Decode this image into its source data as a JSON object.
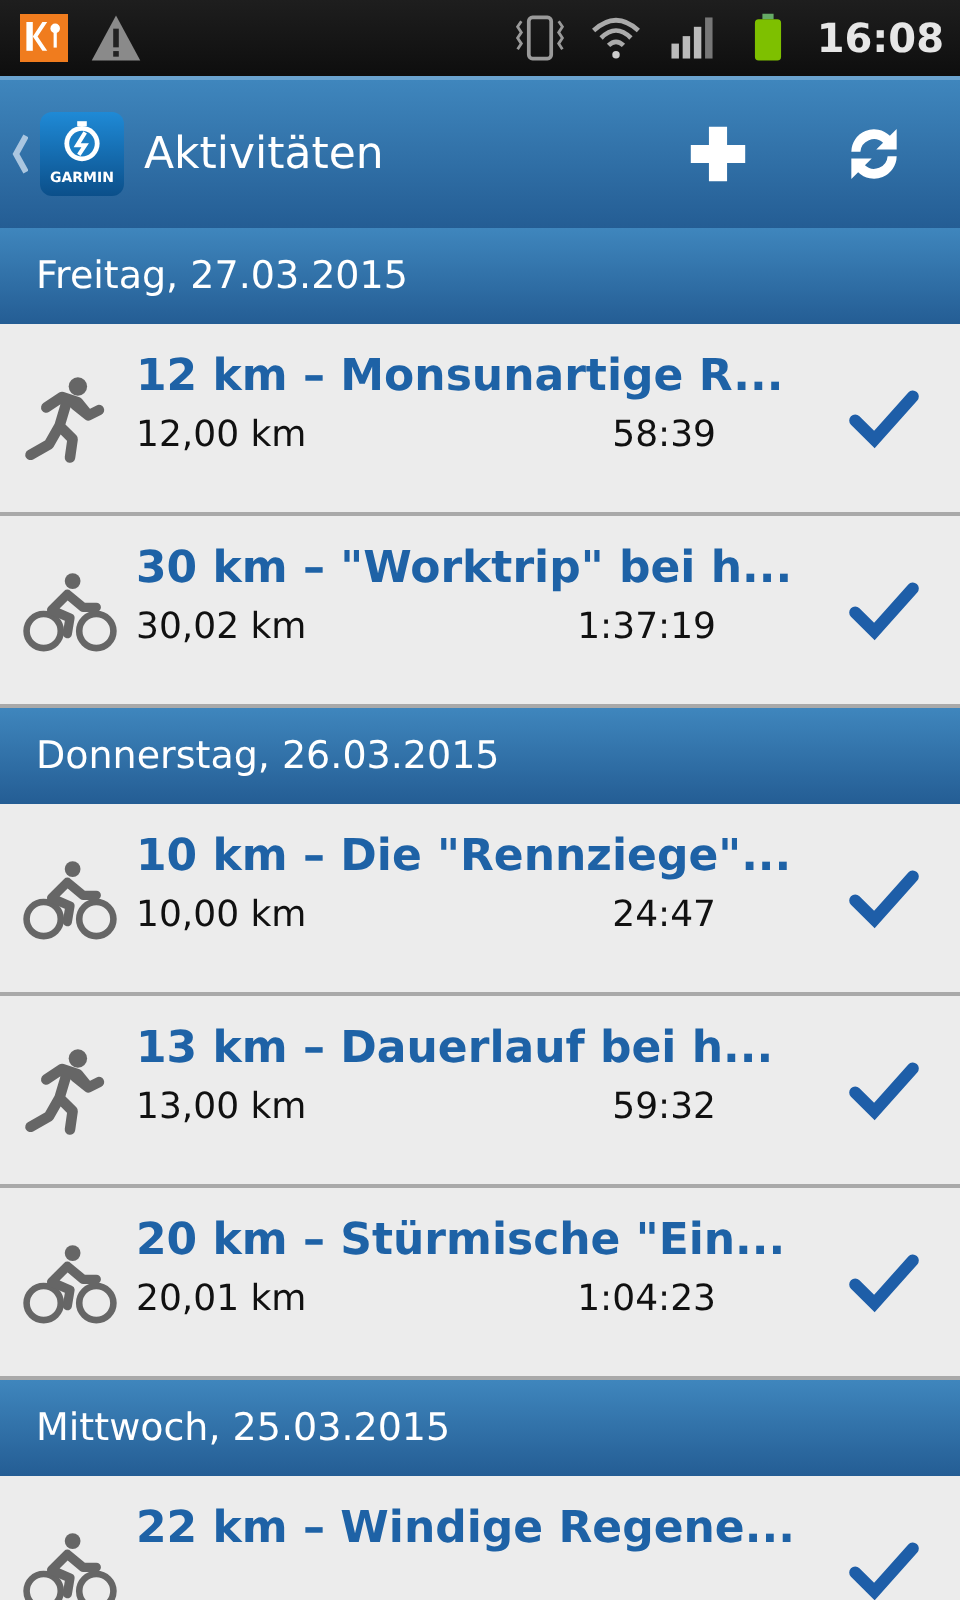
{
  "status_bar": {
    "time": "16:08"
  },
  "action_bar": {
    "logo_text": "GARMIN",
    "title": "Aktivitäten"
  },
  "sections": [
    {
      "date": "Freitag, 27.03.2015",
      "activities": [
        {
          "kind": "run",
          "title": "12 km – Monsunartige R...",
          "distance": "12,00 km",
          "duration": "58:39",
          "synced": true
        },
        {
          "kind": "bike",
          "title": "30 km – \"Worktrip\" bei h...",
          "distance": "30,02 km",
          "duration": "1:37:19",
          "synced": true
        }
      ]
    },
    {
      "date": "Donnerstag, 26.03.2015",
      "activities": [
        {
          "kind": "bike",
          "title": "10 km – Die \"Rennziege\"...",
          "distance": "10,00 km",
          "duration": "24:47",
          "synced": true
        },
        {
          "kind": "run",
          "title": "13 km – Dauerlauf bei h...",
          "distance": "13,00 km",
          "duration": "59:32",
          "synced": true
        },
        {
          "kind": "bike",
          "title": "20 km – Stürmische \"Ein...",
          "distance": "20,01 km",
          "duration": "1:04:23",
          "synced": true
        }
      ]
    },
    {
      "date": "Mittwoch, 25.03.2015",
      "activities": [
        {
          "kind": "bike",
          "title": "22 km – Windige Regene...",
          "synced": true
        }
      ]
    }
  ]
}
